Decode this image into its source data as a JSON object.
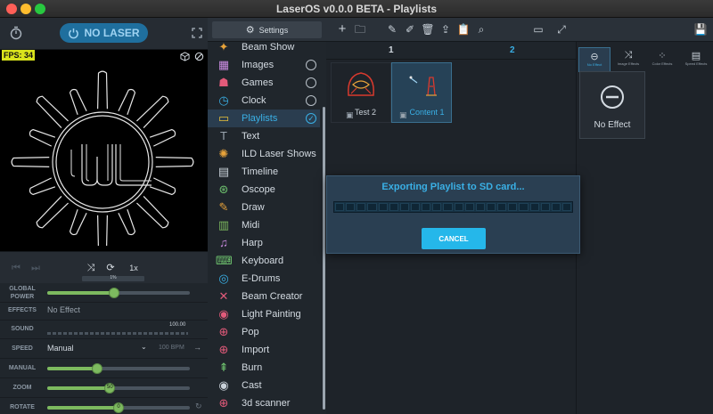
{
  "window": {
    "title": "LaserOS v0.0.0 BETA - Playlists"
  },
  "colors": {
    "accent": "#3ab0e6",
    "slider": "#7dba5f",
    "fps_badge": "#d9e31c",
    "cancel": "#25b7ea"
  },
  "left": {
    "laser_button": "NO LASER",
    "fps": "FPS: 34",
    "transport": {
      "speed_badge": "1x",
      "speed_value": "1%"
    },
    "controls": {
      "global_power": {
        "label": "GLOBAL POWER",
        "value": 0.47
      },
      "effects": {
        "label": "EFFECTS",
        "value": "No Effect"
      },
      "sound": {
        "label": "SOUND",
        "value": "100.00"
      },
      "speed": {
        "label": "SPEED",
        "mode": "Manual",
        "bpm": "100 BPM"
      },
      "manual": {
        "label": "MANUAL",
        "value": 0.35
      },
      "zoom": {
        "label": "ZOOM",
        "value": 0.44,
        "badge": "50"
      },
      "rotate": {
        "label": "ROTATE",
        "value": 0.5,
        "badge": "0"
      }
    }
  },
  "settings_button": "Settings",
  "apps": [
    {
      "label": "Beam Show",
      "icon": "beam-show-icon",
      "radio": false,
      "selected": false
    },
    {
      "label": "Images",
      "icon": "image-icon",
      "radio": true,
      "selected": false
    },
    {
      "label": "Games",
      "icon": "ghost-icon",
      "radio": true,
      "selected": false
    },
    {
      "label": "Clock",
      "icon": "clock-icon",
      "radio": true,
      "selected": false
    },
    {
      "label": "Playlists",
      "icon": "folder-icon",
      "radio": true,
      "selected": true
    },
    {
      "label": "Text",
      "icon": "text-icon",
      "radio": false,
      "selected": false
    },
    {
      "label": "ILD Laser Shows",
      "icon": "sparkle-icon",
      "radio": false,
      "selected": false
    },
    {
      "label": "Timeline",
      "icon": "clapper-icon",
      "radio": false,
      "selected": false
    },
    {
      "label": "Oscope",
      "icon": "oscope-icon",
      "radio": false,
      "selected": false
    },
    {
      "label": "Draw",
      "icon": "pencil-icon",
      "radio": false,
      "selected": false
    },
    {
      "label": "Midi",
      "icon": "piano-icon",
      "radio": false,
      "selected": false
    },
    {
      "label": "Harp",
      "icon": "harp-icon",
      "radio": false,
      "selected": false
    },
    {
      "label": "Keyboard",
      "icon": "keyboard-icon",
      "radio": false,
      "selected": false
    },
    {
      "label": "E-Drums",
      "icon": "drum-icon",
      "radio": false,
      "selected": false
    },
    {
      "label": "Beam Creator",
      "icon": "beam-creator-icon",
      "radio": false,
      "selected": false
    },
    {
      "label": "Light Painting",
      "icon": "camera-icon",
      "radio": false,
      "selected": false
    },
    {
      "label": "Pop",
      "icon": "target-icon",
      "radio": false,
      "selected": false
    },
    {
      "label": "Import",
      "icon": "import-icon",
      "radio": false,
      "selected": false
    },
    {
      "label": "Burn",
      "icon": "burn-icon",
      "radio": false,
      "selected": false
    },
    {
      "label": "Cast",
      "icon": "eye-icon",
      "radio": false,
      "selected": false
    },
    {
      "label": "3d scanner",
      "icon": "scanner-icon",
      "radio": false,
      "selected": false
    }
  ],
  "playlist": {
    "columns": [
      "1",
      "2"
    ],
    "cues": [
      {
        "name": "Test 2",
        "selected": false
      },
      {
        "name": "Content 1",
        "selected": true
      }
    ]
  },
  "effects_panel": {
    "tabs": [
      "No Effect",
      "Image Effects",
      "Color Effects",
      "Speed Effects"
    ],
    "current": "No Effect"
  },
  "modal": {
    "title": "Exporting Playlist to SD card...",
    "progress": 0.0,
    "cancel": "CANCEL"
  }
}
